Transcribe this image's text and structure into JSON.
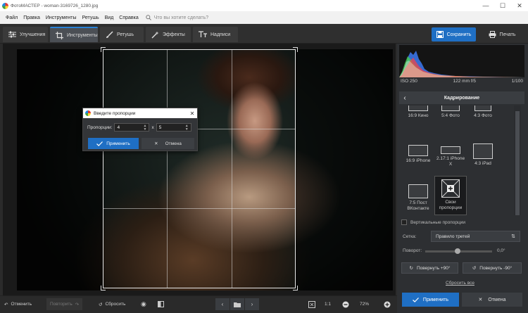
{
  "window": {
    "title": "ФотоМАСТЕР - woman-3169726_1280.jpg",
    "minimize": "—",
    "maximize": "☐",
    "close": "✕"
  },
  "menu": {
    "items": [
      "Файл",
      "Правка",
      "Инструменты",
      "Ретушь",
      "Вид",
      "Справка"
    ],
    "search_placeholder": "Что вы хотите сделать?"
  },
  "toolbar": {
    "tabs": [
      {
        "label": "Улучшения"
      },
      {
        "label": "Инструменты",
        "active": true
      },
      {
        "label": "Ретушь"
      },
      {
        "label": "Эффекты"
      },
      {
        "label": "Надписи"
      }
    ],
    "save_label": "Сохранить",
    "print_label": "Печать"
  },
  "photo_info": {
    "iso": "ISO 250",
    "lens": "122 mm f/5",
    "shutter": "1/100"
  },
  "dialog": {
    "title": "Введите пропорции",
    "proportions_label": "Пропорции:",
    "width_value": "4",
    "separator": "x",
    "height_value": "5",
    "ok_label": "Применить",
    "cancel_label": "Отмена"
  },
  "crop_panel": {
    "title": "Кадрирование",
    "presets": [
      {
        "label": "16:9 Кино"
      },
      {
        "label": "5:4 Фото"
      },
      {
        "label": "4:3 Фото"
      },
      {
        "label": "16:9 iPhone"
      },
      {
        "label": "2.17:1 iPhone X"
      },
      {
        "label": "4:3 iPad"
      },
      {
        "label": "7:5 Пост ВКонтакте"
      },
      {
        "label": "Свои пропорции",
        "selected": true
      }
    ],
    "vertical_label": "Вертикальные пропорции",
    "grid_label": "Сетка:",
    "grid_value": "Правило третей",
    "rotation_label": "Поворот:",
    "rotation_value": "0,0°",
    "rotate_plus_label": "Повернуть +90°",
    "rotate_minus_label": "Повернуть -90°",
    "reset_all_label": "Сбросить все",
    "apply_label": "Применить",
    "cancel_label": "Отмена"
  },
  "bottom": {
    "undo_label": "Отменить",
    "redo_label": "Повторить",
    "reset_label": "Сбросить",
    "ratio_label": "1:1",
    "zoom_value": "72%"
  },
  "colors": {
    "accent": "#1f6fc4",
    "panel": "#2d2f32",
    "toolbar": "#2f2f2f"
  }
}
